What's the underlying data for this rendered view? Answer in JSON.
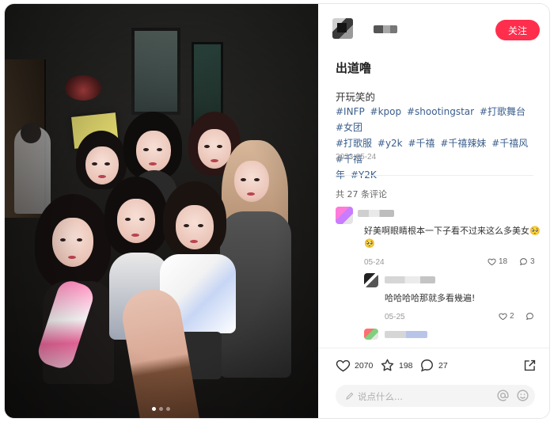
{
  "post": {
    "author_name": "",
    "follow_label": "关注",
    "title": "出道噜",
    "text": "开玩笑的",
    "tags": [
      "#INFP",
      "#kpop",
      "#shootingstar",
      "#打歌舞台",
      "#女团",
      "#打歌服",
      "#y2k",
      "#千禧",
      "#千禧辣妹",
      "#千禧风",
      "#千禧",
      "年",
      "#Y2K"
    ],
    "date": "2023-05-24",
    "image_count": 3,
    "image_index": 1
  },
  "comments": {
    "count_label": "共 27 条评论",
    "items": [
      {
        "text": "好美啊眼睛根本一下子看不过来这么多美女🥺",
        "text_line2": "🥺",
        "date": "05-24",
        "likes": "18",
        "replies": "3"
      },
      {
        "text": "哈哈哈哈那就多看幾遍!",
        "date": "05-25",
        "likes": "2",
        "replies": ""
      }
    ]
  },
  "actions": {
    "likes": "2070",
    "collects": "198",
    "comments": "27",
    "input_placeholder": "说点什么..."
  },
  "colors": {
    "accent": "#ff2e4d",
    "tag": "#3b5e8c"
  }
}
